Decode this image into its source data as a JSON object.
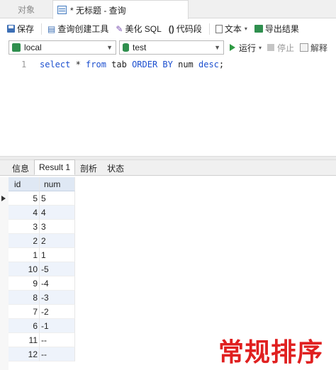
{
  "tabs": {
    "objects": "对象",
    "query": "* 无标题 - 查询"
  },
  "toolbar": {
    "save": "保存",
    "query_builder": "查询创建工具",
    "beautify": "美化 SQL",
    "snippet": "代码段",
    "text": "文本",
    "export": "导出结果"
  },
  "connection": {
    "server": "local",
    "database": "test",
    "run": "运行",
    "stop": "停止",
    "explain": "解释"
  },
  "editor": {
    "line_number": "1",
    "code_tokens": [
      {
        "t": "select",
        "kw": true
      },
      {
        "t": " * ",
        "kw": false
      },
      {
        "t": "from",
        "kw": true
      },
      {
        "t": " tab ",
        "kw": false
      },
      {
        "t": "ORDER BY",
        "kw": true
      },
      {
        "t": " num ",
        "kw": false
      },
      {
        "t": "desc",
        "kw": true
      },
      {
        "t": ";",
        "kw": false
      }
    ]
  },
  "result_tabs": [
    "信息",
    "Result 1",
    "剖析",
    "状态"
  ],
  "result_active_tab": 1,
  "grid": {
    "columns": [
      "id",
      "num"
    ],
    "rows": [
      [
        "5",
        "5"
      ],
      [
        "4",
        "4"
      ],
      [
        "3",
        "3"
      ],
      [
        "2",
        "2"
      ],
      [
        "1",
        "1"
      ],
      [
        "10",
        "-5"
      ],
      [
        "9",
        "-4"
      ],
      [
        "8",
        "-3"
      ],
      [
        "7",
        "-2"
      ],
      [
        "6",
        "-1"
      ],
      [
        "11",
        "--"
      ],
      [
        "12",
        "--"
      ]
    ],
    "selected_row": 0
  },
  "caption": "常规排序",
  "colors": {
    "keyword": "#1c4fcf",
    "caption": "#e02020",
    "row_alt": "#eef3fb",
    "header": "#dfe8f4"
  }
}
